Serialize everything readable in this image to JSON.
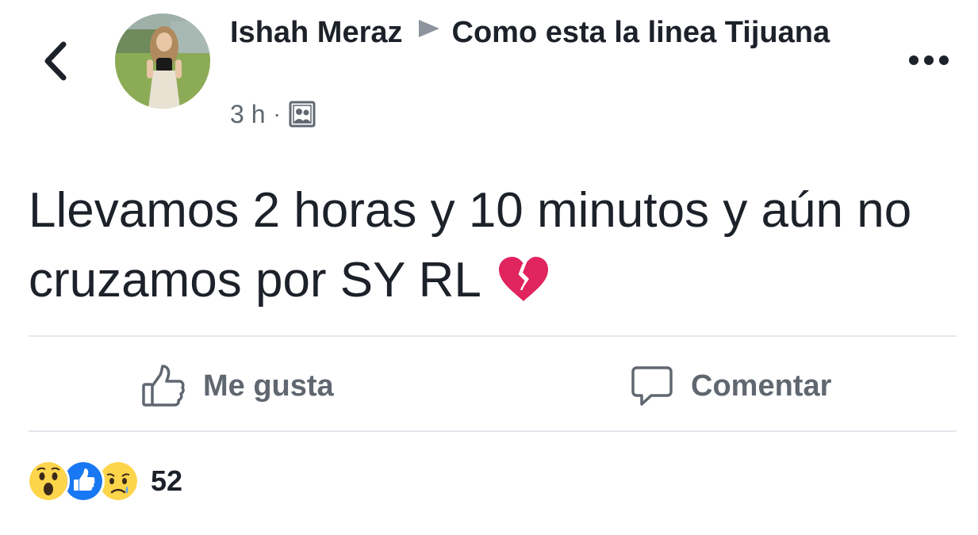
{
  "post": {
    "author": "Ishah Meraz",
    "group": "Como esta la linea Tijuana",
    "time": "3 h",
    "separator": "·",
    "privacy_icon": "group-icon",
    "text": "Llevamos 2 horas y 10 minutos y aún no cruzamos por SY RL",
    "emoji_icon": "broken-heart-icon"
  },
  "actions": {
    "like_label": "Me gusta",
    "comment_label": "Comentar"
  },
  "reactions": {
    "icons": [
      "wow-icon",
      "like-reaction-icon",
      "sad-icon"
    ],
    "count": "52"
  },
  "colors": {
    "text": "#1d2129",
    "secondary": "#606770",
    "like_blue": "#1877f2",
    "emoji_yellow": "#fdd54b",
    "heart_red": "#e0245e"
  }
}
